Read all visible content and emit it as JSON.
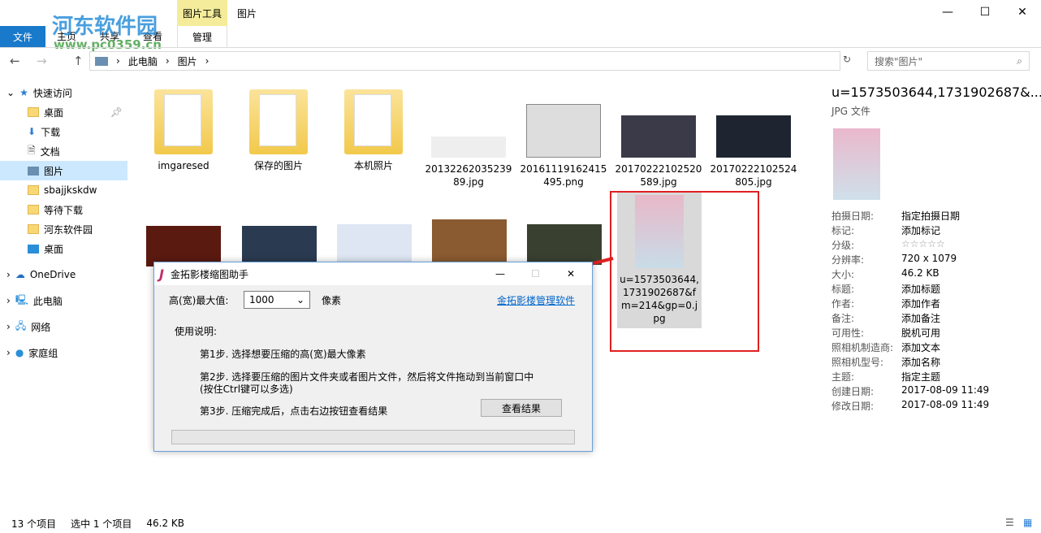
{
  "window": {
    "title": "图片",
    "context_tab": "图片工具",
    "context_subtab": "管理",
    "file_tab": "文件",
    "tabs": [
      "主页",
      "共享",
      "查看"
    ],
    "minimize": "—",
    "maximize": "☐",
    "close": "✕"
  },
  "watermark": {
    "text": "河东软件园",
    "url": "www.pc0359.cn"
  },
  "address": {
    "crumbs": [
      "此电脑",
      "图片"
    ],
    "search_placeholder": "搜索\"图片\""
  },
  "nav": {
    "items": [
      {
        "label": "快速访问",
        "icon": "star-icon"
      },
      {
        "label": "桌面",
        "icon": "folder-icon",
        "pinned": true
      },
      {
        "label": "下载",
        "icon": "download-icon",
        "pinned": true
      },
      {
        "label": "文档",
        "icon": "document-icon",
        "pinned": true
      },
      {
        "label": "图片",
        "icon": "pictures-icon",
        "pinned": true,
        "selected": true
      },
      {
        "label": "sbajjkskdw",
        "icon": "folder-icon"
      },
      {
        "label": "等待下载",
        "icon": "folder-icon"
      },
      {
        "label": "河东软件园",
        "icon": "folder-icon"
      },
      {
        "label": "桌面",
        "icon": "desktop-icon"
      },
      {
        "label": "OneDrive",
        "icon": "cloud-icon"
      },
      {
        "label": "此电脑",
        "icon": "computer-icon"
      },
      {
        "label": "网络",
        "icon": "network-icon"
      },
      {
        "label": "家庭组",
        "icon": "homegroup-icon"
      }
    ]
  },
  "files": [
    {
      "name": "imgaresed",
      "type": "folder"
    },
    {
      "name": "保存的图片",
      "type": "folder"
    },
    {
      "name": "本机照片",
      "type": "folder"
    },
    {
      "name": "2013226203523989.jpg",
      "type": "image"
    },
    {
      "name": "20161119162415495.png",
      "type": "image"
    },
    {
      "name": "20170222102520589.jpg",
      "type": "image"
    },
    {
      "name": "20170222102524805.jpg",
      "type": "image"
    },
    {
      "name": "u=1573503644,1731902687&fm=214&gp=0.jpg",
      "type": "image",
      "selected": true
    }
  ],
  "details": {
    "title": "u=1573503644,1731902687&...",
    "type": "JPG 文件",
    "rating_stars": 0,
    "rows": [
      [
        "拍摄日期:",
        "指定拍摄日期"
      ],
      [
        "标记:",
        "添加标记"
      ],
      [
        "分级:",
        "☆☆☆☆☆"
      ],
      [
        "分辨率:",
        "720 x 1079"
      ],
      [
        "大小:",
        "46.2 KB"
      ],
      [
        "标题:",
        "添加标题"
      ],
      [
        "作者:",
        "添加作者"
      ],
      [
        "备注:",
        "添加备注"
      ],
      [
        "可用性:",
        "脱机可用"
      ],
      [
        "照相机制造商:",
        "添加文本"
      ],
      [
        "照相机型号:",
        "添加名称"
      ],
      [
        "主题:",
        "指定主题"
      ],
      [
        "创建日期:",
        "2017-08-09 11:49"
      ],
      [
        "修改日期:",
        "2017-08-09 11:49"
      ]
    ]
  },
  "status": {
    "count": "13 个项目",
    "selection": "选中 1 个项目",
    "size": "46.2 KB"
  },
  "dialog": {
    "title": "金拓影楼缩图助手",
    "max_label": "高(宽)最大值:",
    "max_value": "1000",
    "unit": "像素",
    "link": "金拓影楼管理软件",
    "usage": "使用说明:",
    "step1": "第1步. 选择想要压缩的高(宽)最大像素",
    "step2": "第2步. 选择要压缩的图片文件夹或者图片文件，然后将文件拖动到当前窗口中",
    "step2b": "(按住Ctrl键可以多选)",
    "step3": "第3步. 压缩完成后，点击右边按钮查看结果",
    "button": "查看结果",
    "progress": 0
  },
  "colors": {
    "accent": "#1979ca",
    "highlight": "#cce8ff",
    "annotation": "#e02020",
    "link": "#0066cc"
  }
}
